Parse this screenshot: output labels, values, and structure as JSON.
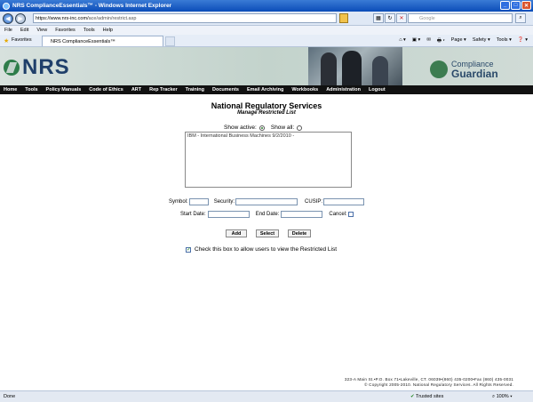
{
  "window": {
    "title": "NRS ComplianceEssentials™ - Windows Internet Explorer",
    "min": "_",
    "max": "□",
    "close": "✕"
  },
  "browser": {
    "back": "◀",
    "forward": "▶",
    "address": "https://www.nrs-inc.com/",
    "address_path": "ace/admin/restrict.asp",
    "search_placeholder": "Google",
    "menu": [
      "File",
      "Edit",
      "View",
      "Favorites",
      "Tools",
      "Help"
    ],
    "favorites_label": "Favorites",
    "tab_title": "NRS ComplianceEssentials™",
    "commands": [
      "⌂ ▾",
      "▣ ▾",
      "✉",
      "🖶 ▾",
      "Page ▾",
      "Safety ▾",
      "Tools ▾",
      "❓ ▾"
    ]
  },
  "header": {
    "logo": "NRS",
    "cg_line1": "Compliance",
    "cg_line2": "Guardian"
  },
  "nav": [
    "Home",
    "Tools",
    "Policy Manuals",
    "Code of Ethics",
    "ART",
    "Rep Tracker",
    "Training",
    "Documents",
    "Email Archiving",
    "Workbooks",
    "Administration",
    "Logout"
  ],
  "main": {
    "title": "National Regulatory Services",
    "subtitle": "Manage Restricted List",
    "show_active": "Show active:",
    "show_all": "Show all:",
    "show_active_selected": true,
    "list_items": [
      "IBM - International Business Machines 9/2/2010 -"
    ],
    "form": {
      "symbol": "Symbol:",
      "symbol_value": "",
      "security": "Security:",
      "security_value": "",
      "cusip": "CUSIP:",
      "cusip_value": "",
      "start_date": "Start Date:",
      "start_value": "",
      "end_date": "End Date:",
      "end_value": "",
      "cancel": "Cancel:",
      "cancel_checked": false
    },
    "buttons": {
      "add": "Add",
      "select": "Select",
      "delete": "Delete"
    },
    "allow_checked": true,
    "allow_text": "Check this box to allow users to view the Restricted List"
  },
  "footer": {
    "line1": "323-A Main St.•P.O. Box 71•Lakeville, CT. 06039•(860) 435-0200•Fax (860) 435-0031",
    "line2": "© Copyright 2005-2010. National Regulatory Services. All Rights Reserved."
  },
  "status": {
    "done": "Done",
    "trusted": "Trusted sites",
    "zoom": "100%"
  }
}
